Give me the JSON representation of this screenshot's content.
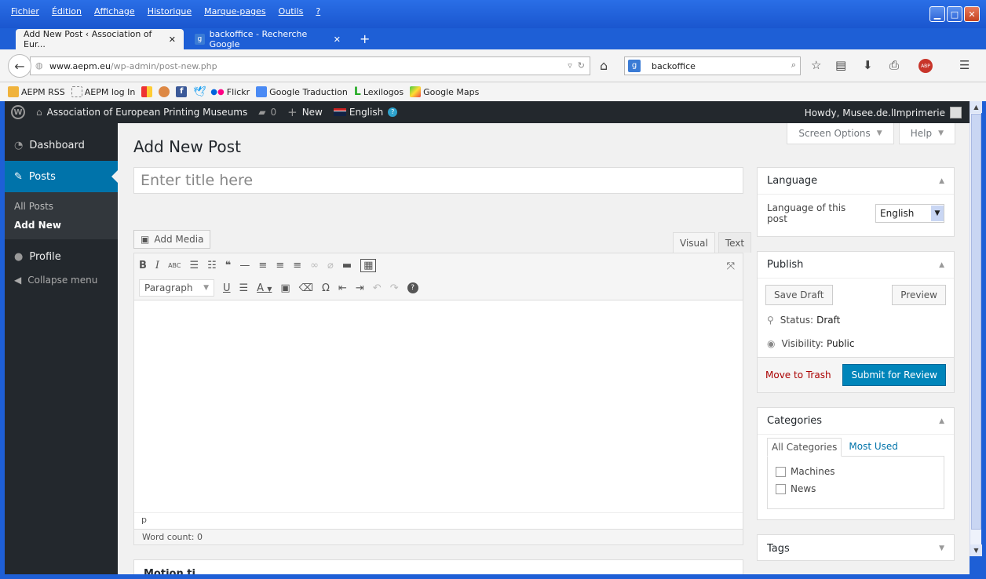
{
  "browser": {
    "menu": [
      "Fichier",
      "Édition",
      "Affichage",
      "Historique",
      "Marque-pages",
      "Outils",
      "?"
    ],
    "tabs": [
      {
        "title": "Add New Post ‹ Association of Eur..."
      },
      {
        "title": "backoffice - Recherche Google"
      }
    ],
    "url_host": "www.aepm.eu",
    "url_path": "/wp-admin/post-new.php",
    "search_value": "backoffice",
    "bookmarks": [
      "AEPM RSS",
      "AEPM log In",
      "Flickr",
      "Google Traduction",
      "Lexilogos",
      "Google Maps"
    ],
    "abp_label": "ABP"
  },
  "adminbar": {
    "site": "Association of European Printing Museums",
    "comments": "0",
    "new": "New",
    "language": "English",
    "howdy": "Howdy, Musee.de.lImprimerie"
  },
  "sidebar": {
    "dashboard": "Dashboard",
    "posts": "Posts",
    "all_posts": "All Posts",
    "add_new": "Add New",
    "profile": "Profile",
    "collapse": "Collapse menu"
  },
  "main": {
    "screen_options": "Screen Options",
    "help": "Help",
    "page_title": "Add New Post",
    "title_placeholder": "Enter title here",
    "add_media": "Add Media",
    "tab_visual": "Visual",
    "tab_text": "Text",
    "format_select": "Paragraph",
    "path": "p",
    "word_count": "Word count: 0",
    "metabox_partial": "Motion ti..."
  },
  "language_box": {
    "title": "Language",
    "label": "Language of this post",
    "value": "English"
  },
  "publish_box": {
    "title": "Publish",
    "save_draft": "Save Draft",
    "preview": "Preview",
    "status_label": "Status:",
    "status_value": "Draft",
    "visibility_label": "Visibility:",
    "visibility_value": "Public",
    "trash": "Move to Trash",
    "submit": "Submit for Review"
  },
  "categories_box": {
    "title": "Categories",
    "tab_all": "All Categories",
    "tab_used": "Most Used",
    "items": [
      "Machines",
      "News"
    ]
  },
  "tags_box": {
    "title": "Tags"
  },
  "colors": {
    "accent": "#0085ba",
    "admin_bar": "#23282d",
    "trash": "#a00"
  }
}
